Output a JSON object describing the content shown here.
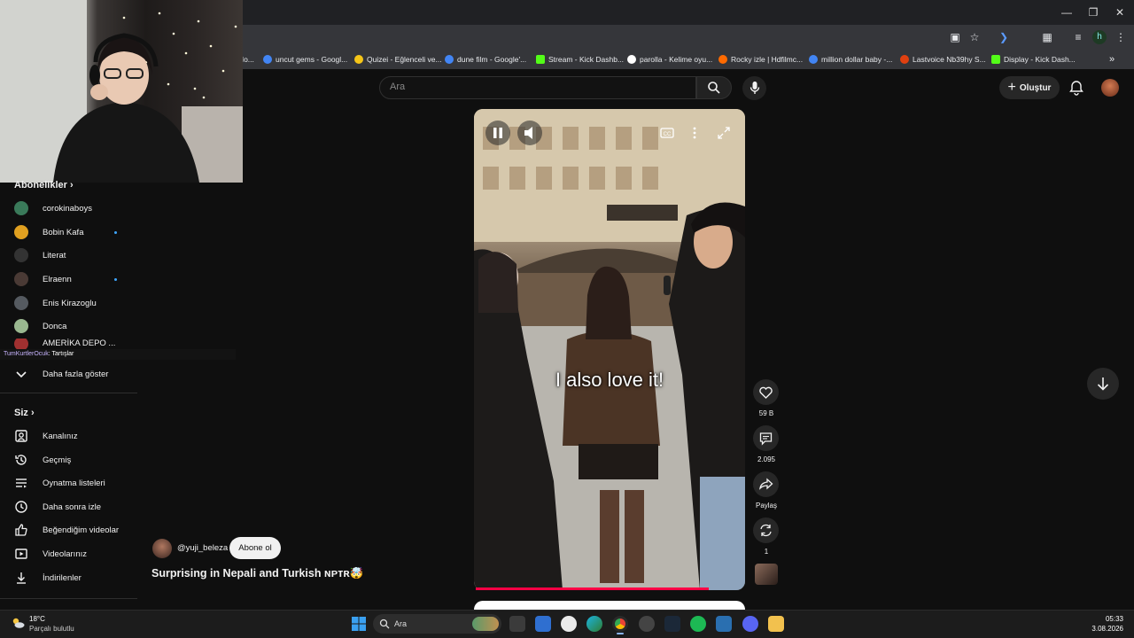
{
  "browser": {
    "bookmarks": [
      {
        "label": "Mo...",
        "color": "#888888"
      },
      {
        "label": "uncut gems - Googl...",
        "color": "#4285f4"
      },
      {
        "label": "Quizei - Eğlenceli ve...",
        "color": "#f5c518"
      },
      {
        "label": "dune film - Google'...",
        "color": "#4285f4"
      },
      {
        "label": "Stream - Kick Dashb...",
        "color": "#53fc18"
      },
      {
        "label": "parolla - Kelime oyu...",
        "color": "#ffffff"
      },
      {
        "label": "Rocky izle | Hdfilmc...",
        "color": "#ff6a00"
      },
      {
        "label": "million dollar baby -...",
        "color": "#4285f4"
      },
      {
        "label": "Lastvoice Nb39hy S...",
        "color": "#e04010"
      },
      {
        "label": "Display - Kick Dash...",
        "color": "#53fc18"
      }
    ],
    "bookmarks_more": "»",
    "profile_initial": "h"
  },
  "youtube": {
    "search_placeholder": "Ara",
    "create_label": "Oluştur",
    "subscriptions_title": "Abonelikler",
    "subscriptions": [
      {
        "name": "corokinaboys",
        "color": "#3a7a5a",
        "live": false
      },
      {
        "name": "Bobin Kafa",
        "color": "#e0a020",
        "live": true
      },
      {
        "name": "Literat",
        "color": "#333333",
        "live": false
      },
      {
        "name": "Elraenn",
        "color": "#4a3a35",
        "live": true
      },
      {
        "name": "Enis Kirazoglu",
        "color": "#555a60",
        "live": false
      },
      {
        "name": "Donca",
        "color": "#9ab890",
        "live": false
      },
      {
        "name": "AMERİKA DEPO ...",
        "color": "#a03030",
        "live": false
      }
    ],
    "show_more": "Daha fazla göster",
    "you_title": "Siz",
    "you_items": [
      "Kanalınız",
      "Geçmiş",
      "Oynatma listeleri",
      "Daha sonra izle",
      "Beğendiğim videolar",
      "Videolarınız",
      "İndirilenler"
    ],
    "chat_overlay": {
      "user": "TumKurtlerOcuk",
      "message": ": Tartışlar"
    },
    "short": {
      "caption": "I also love it!",
      "channel": "@yuji_beleza",
      "subscribe_label": "Abone ol",
      "title": "Surprising in Nepali and Turkish ɴᴘᴛʀ🤯",
      "likes": "59 B",
      "comments": "2.095",
      "share_label": "Paylaş",
      "remix_count": "1",
      "progress": 0.87
    }
  },
  "taskbar": {
    "weather_temp": "18°C",
    "weather_desc": "Parçalı bulutlu",
    "search_label": "Ara",
    "time": "05:33",
    "date": "3.08.2026",
    "apps": [
      "windows",
      "search",
      "task-view",
      "file-manager",
      "store",
      "chatgpt",
      "edge",
      "chrome",
      "steam",
      "obs",
      "spotify",
      "vpn",
      "discord",
      "folder"
    ]
  }
}
